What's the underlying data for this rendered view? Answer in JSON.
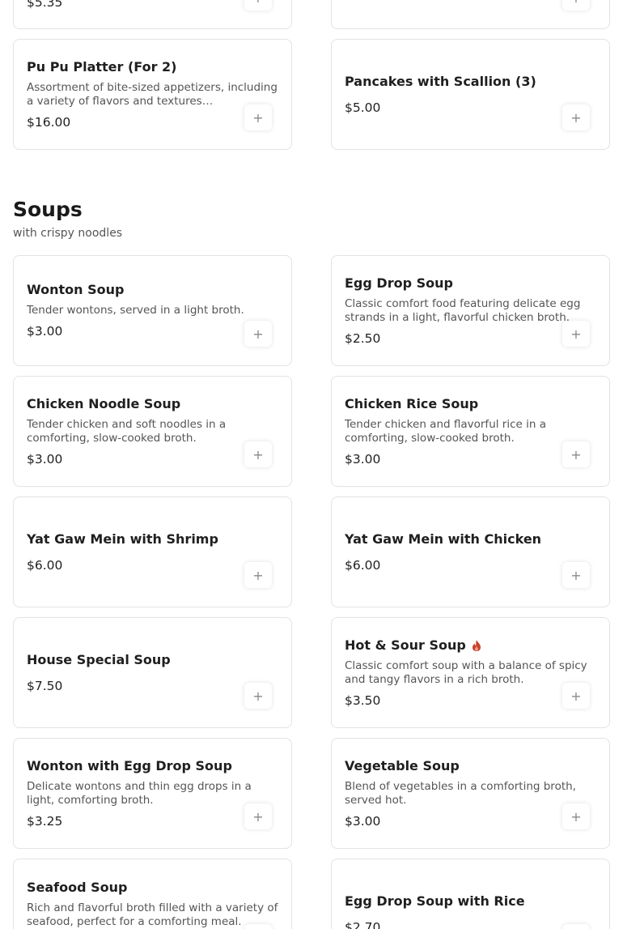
{
  "top_partial": {
    "left_price": "$5.35"
  },
  "appetizers": [
    {
      "name": "Pu Pu Platter (For 2)",
      "description": "Assortment of bite-sized appetizers, including a variety of flavors and textures…",
      "price": "$16.00"
    },
    {
      "name": "Pancakes with Scallion (3)",
      "description": "",
      "price": "$5.00"
    }
  ],
  "section": {
    "title": "Soups",
    "subtitle": "with crispy noodles"
  },
  "soups": [
    {
      "name": "Wonton Soup",
      "description": "Tender wontons, served in a light broth.",
      "price": "$3.00"
    },
    {
      "name": "Egg Drop Soup",
      "description": "Classic comfort food featuring delicate egg strands in a light, flavorful chicken broth.",
      "price": "$2.50"
    },
    {
      "name": "Chicken Noodle Soup",
      "description": "Tender chicken and soft noodles in a comforting, slow-cooked broth.",
      "price": "$3.00"
    },
    {
      "name": "Chicken Rice Soup",
      "description": "Tender chicken and flavorful rice in a comforting, slow-cooked broth.",
      "price": "$3.00"
    },
    {
      "name": "Yat Gaw Mein with Shrimp",
      "description": "",
      "price": "$6.00"
    },
    {
      "name": "Yat Gaw Mein with Chicken",
      "description": "",
      "price": "$6.00"
    },
    {
      "name": "House Special Soup",
      "description": "",
      "price": "$7.50"
    },
    {
      "name": "Hot & Sour Soup",
      "description": "Classic comfort soup with a balance of spicy and tangy flavors in a rich broth.",
      "price": "$3.50",
      "spicy": true
    },
    {
      "name": "Wonton with Egg Drop Soup",
      "description": "Delicate wontons and thin egg drops in a light, comforting broth.",
      "price": "$3.25"
    },
    {
      "name": "Vegetable Soup",
      "description": "Blend of vegetables in a comforting broth, served hot.",
      "price": "$3.00"
    },
    {
      "name": "Seafood Soup",
      "description": "Rich and flavorful broth filled with a variety of seafood, perfect for a comforting meal.",
      "price": ""
    },
    {
      "name": "Egg Drop Soup with Rice",
      "description": "",
      "price": "$2.70"
    }
  ],
  "icons": {
    "add": "plus-icon",
    "spicy": "flame-icon"
  },
  "colors": {
    "spicy": "#d9442b"
  }
}
